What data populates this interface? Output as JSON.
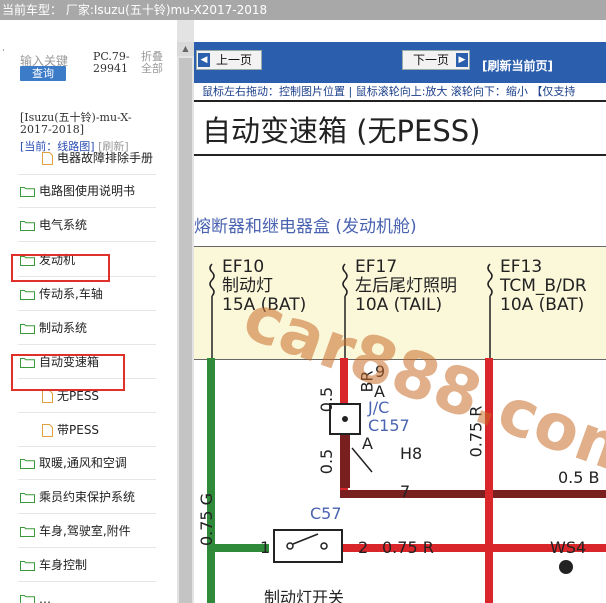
{
  "title": "当前车型： 厂家:Isuzu(五十铃)mu-X2017-2018",
  "left": {
    "top_dot": "‧",
    "search_label": "输入关键",
    "query_button": "查询",
    "pc_code": "PC.79-29941",
    "fold_all": "折叠全部",
    "model_info": "[Isuzu(五十铃)-mu-X-2017-2018]",
    "current_prefix": "[当前：线路图]",
    "refresh": "[刷新]",
    "tree": [
      {
        "label": "电器故障排除手册",
        "icon": "doc-icon",
        "indent": 2
      },
      {
        "label": "电路图使用说明书",
        "icon": "folder-icon",
        "indent": 1
      },
      {
        "label": "电气系统",
        "icon": "folder-icon",
        "indent": 1
      },
      {
        "label": "发动机",
        "icon": "folder-icon",
        "indent": 1,
        "highlighted": true
      },
      {
        "label": "传动系,车轴",
        "icon": "folder-icon",
        "indent": 1
      },
      {
        "label": "制动系统",
        "icon": "folder-icon",
        "indent": 1
      },
      {
        "label": "自动变速箱",
        "icon": "folder-open-icon",
        "indent": 1,
        "highlighted": true
      },
      {
        "label": "无PESS",
        "icon": "doc-icon",
        "indent": 2
      },
      {
        "label": "带PESS",
        "icon": "doc-icon",
        "indent": 2
      },
      {
        "label": "取暖,通风和空调",
        "icon": "folder-icon",
        "indent": 1
      },
      {
        "label": "乘员约束保护系统",
        "icon": "folder-icon",
        "indent": 1
      },
      {
        "label": "车身,驾驶室,附件",
        "icon": "folder-icon",
        "indent": 1
      },
      {
        "label": "车身控制",
        "icon": "folder-icon",
        "indent": 1
      },
      {
        "label": "…",
        "icon": "folder-icon",
        "indent": 1
      }
    ]
  },
  "right": {
    "prev_button": "上一页",
    "next_button": "下一页",
    "refresh_page": "[刷新当前页]",
    "hint": "鼠标左右拖动：控制图片位置 | 鼠标滚轮向上:放大  滚轮向下：缩小 【仅支持",
    "diagram": {
      "title": "自动变速箱 (无PESS)",
      "fuse_caption": "熔断器和继电器盒 (发动机舱)",
      "fuses": [
        {
          "id": "EF10",
          "name": "制动灯",
          "rating": "15A (BAT)"
        },
        {
          "id": "EF17",
          "name": "左后尾灯照明",
          "rating": "10A (TAIL)"
        },
        {
          "id": "EF13",
          "name": "TCM_B/DR",
          "rating": "10A (BAT)"
        }
      ],
      "wire_labels": {
        "br9": "9",
        "br": "BR",
        "a": "A",
        "jc": "J/C",
        "c157": "C157",
        "h8": "H8",
        "n7": "7",
        "w05": "0.5",
        "w05b": "0.5",
        "w075r": "0.75 R",
        "w05b_right": "0.5 B",
        "w075g": "0.75 G",
        "c57": "C57",
        "pin1": "1",
        "pin2": "2",
        "w075r_bottom": "0.75 R",
        "ws4": "WS4",
        "brake_switch": "制动灯开关"
      },
      "watermark": "car888.com"
    }
  },
  "colors": {
    "nav_bar": "#2b5fae",
    "query_button": "#3c7bc8",
    "highlight": "#e0302a",
    "wire_green": "#2f8a3a",
    "wire_red": "#d9262a",
    "wire_brown": "#7a1f1f",
    "fuse_box": "#fbf7d9"
  }
}
